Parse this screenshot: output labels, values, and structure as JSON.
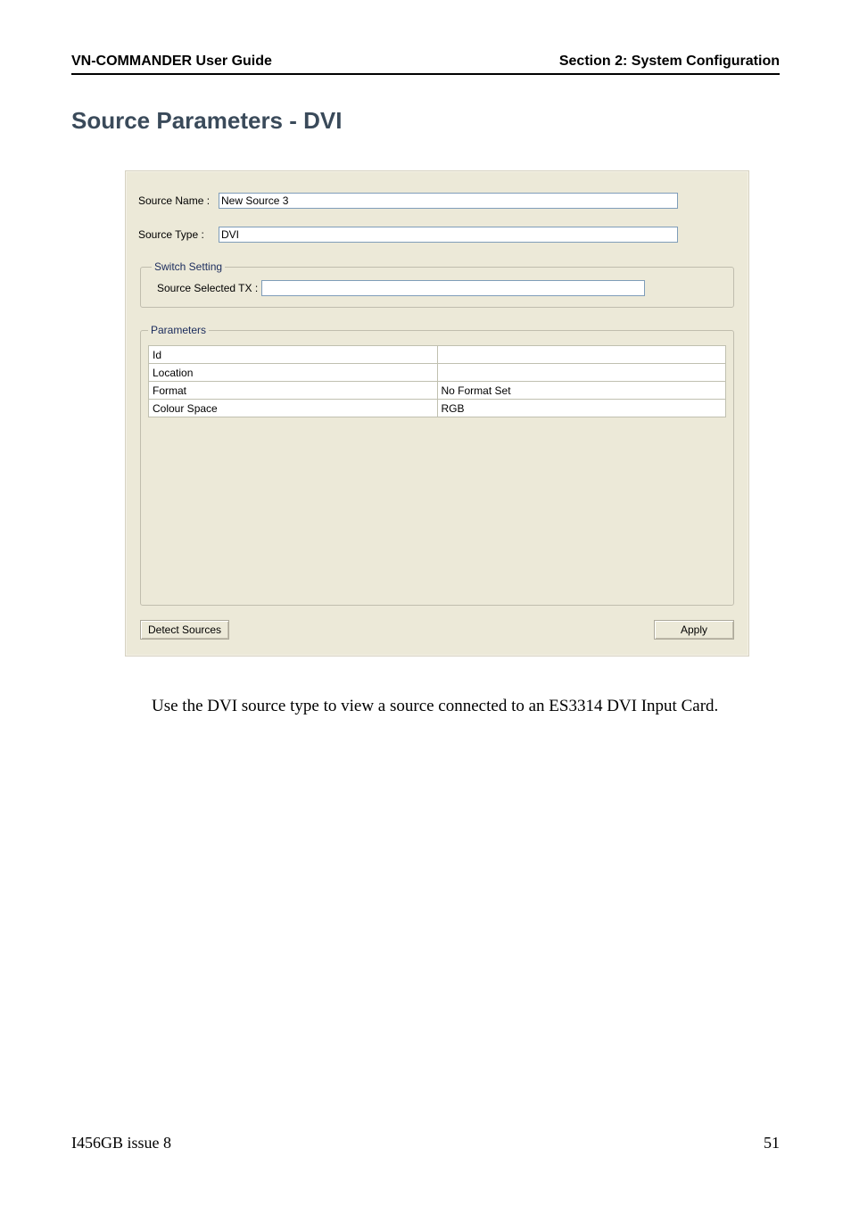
{
  "header": {
    "left": "VN-COMMANDER User Guide",
    "right": "Section 2: System Configuration"
  },
  "title": "Source Parameters - DVI",
  "form": {
    "source_name_label": "Source Name :",
    "source_name_value": "New Source 3",
    "source_type_label": "Source Type :",
    "source_type_value": "DVI",
    "switch_legend": "Switch Setting",
    "switch_label": "Source Selected TX :",
    "switch_value": "",
    "parameters_legend": "Parameters",
    "param_rows": [
      {
        "label": "Id",
        "value": ""
      },
      {
        "label": "Location",
        "value": ""
      },
      {
        "label": "Format",
        "value": "No Format Set"
      },
      {
        "label": "Colour Space",
        "value": "RGB"
      }
    ],
    "detect_label": "Detect Sources",
    "apply_label": "Apply"
  },
  "body_text": "Use the DVI source type to view a source connected to an ES3314 DVI Input Card.",
  "footer": {
    "left": "I456GB issue 8",
    "right": "51"
  }
}
